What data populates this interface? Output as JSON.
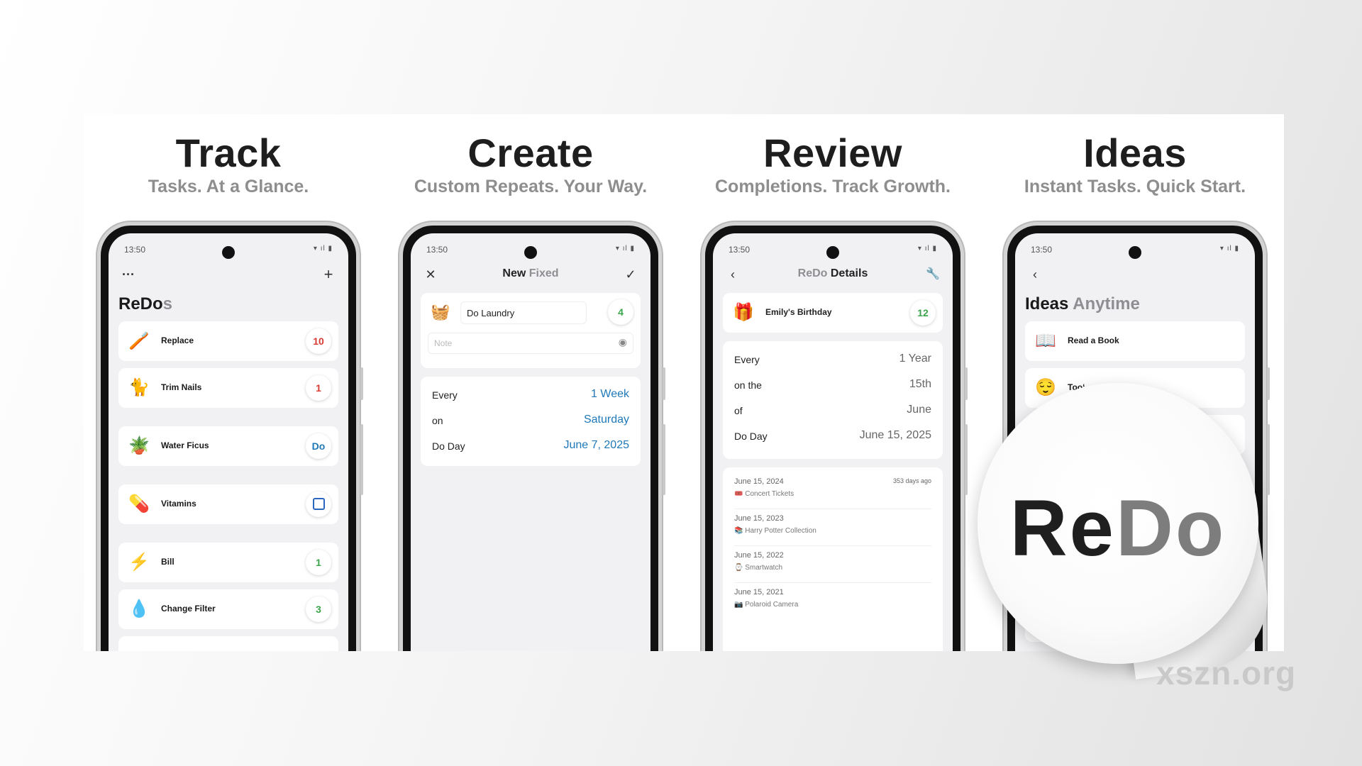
{
  "columns": [
    {
      "title": "Track",
      "subtitle": "Tasks. At a Glance."
    },
    {
      "title": "Create",
      "subtitle": "Custom Repeats. Your Way."
    },
    {
      "title": "Review",
      "subtitle": "Completions. Track Growth."
    },
    {
      "title": "Ideas",
      "subtitle": "Instant Tasks. Quick Start."
    }
  ],
  "status": {
    "time": "13:50",
    "icons": "wifi-icon signal-icon battery-icon"
  },
  "track": {
    "title_main": "ReDo",
    "title_dim": "s",
    "more_icon": "more-icon",
    "add_icon": "plus-icon",
    "items": [
      {
        "emoji": "🪥",
        "label": "Replace",
        "badge": "10",
        "badge_color": "#d93a32"
      },
      {
        "emoji": "🐈",
        "label": "Trim Nails",
        "badge": "1",
        "badge_color": "#d93a32"
      },
      {
        "emoji": "🪴",
        "label": "Water Ficus",
        "badge": "Do",
        "badge_color": "#1f78b8"
      },
      {
        "emoji": "💊",
        "label": "Vitamins",
        "badge": "checkbox",
        "badge_color": "#2a66c0"
      },
      {
        "emoji": "⚡",
        "label": "Bill",
        "badge": "1",
        "badge_color": "#3aa54b"
      },
      {
        "emoji": "💧",
        "label": "Change Filter",
        "badge": "3",
        "badge_color": "#3aa54b"
      }
    ]
  },
  "create": {
    "title_main": "New",
    "title_dim": "Fixed",
    "task": {
      "emoji": "🧺",
      "name": "Do Laundry",
      "badge": "4"
    },
    "note_placeholder": "Note",
    "rows": [
      {
        "key": "Every",
        "value": "1   Week"
      },
      {
        "key": "on",
        "value": "Saturday"
      },
      {
        "key": "Do Day",
        "value": "June 7, 2025"
      }
    ]
  },
  "review": {
    "title_dim": "ReDo",
    "title_main": "Details",
    "task": {
      "emoji": "🎁",
      "name": "Emily's Birthday",
      "badge": "12"
    },
    "rows": [
      {
        "key": "Every",
        "value": "1   Year"
      },
      {
        "key": "on the",
        "value": "15th"
      },
      {
        "key": "of",
        "value": "June"
      },
      {
        "key": "Do Day",
        "value": "June 15, 2025"
      }
    ],
    "history": [
      {
        "date": "June 15, 2024",
        "gift": "🎟️ Concert Tickets",
        "ago": "353 days ago"
      },
      {
        "date": "June 15, 2023",
        "gift": "📚 Harry Potter Collection",
        "ago": ""
      },
      {
        "date": "June 15, 2022",
        "gift": "⌚ Smartwatch",
        "ago": ""
      },
      {
        "date": "June 15, 2021",
        "gift": "📷 Polaroid Camera",
        "ago": ""
      }
    ]
  },
  "ideas": {
    "title_main": "Ideas",
    "title_dim": "Anytime",
    "items": [
      {
        "emoji": "📖",
        "label": "Read a Book"
      },
      {
        "emoji": "😌",
        "label": "Tooʻ"
      }
    ]
  },
  "sticker": {
    "logo_main": "Re",
    "logo_dim": "Do"
  },
  "watermark": "xszn.org"
}
